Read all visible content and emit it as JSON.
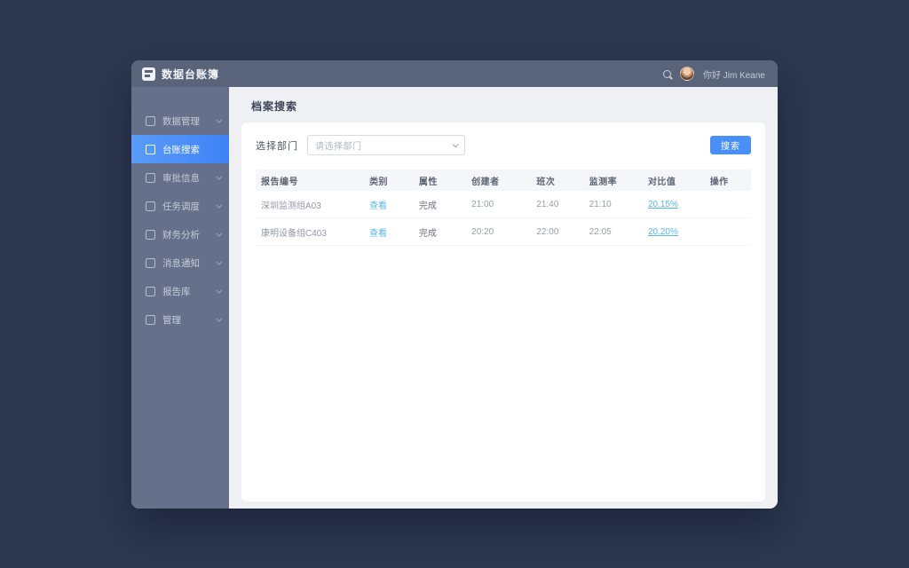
{
  "app": {
    "title": "数据台账簿",
    "greeting": "你好 Jim Keane"
  },
  "sidebar": {
    "items": [
      {
        "label": "数据管理",
        "active": false
      },
      {
        "label": "台账搜索",
        "active": true
      },
      {
        "label": "审批信息",
        "active": false
      },
      {
        "label": "任务调度",
        "active": false
      },
      {
        "label": "财务分析",
        "active": false
      },
      {
        "label": "消息通知",
        "active": false
      },
      {
        "label": "报告库",
        "active": false
      },
      {
        "label": "管理",
        "active": false
      }
    ]
  },
  "page": {
    "title": "档案搜索"
  },
  "filter": {
    "label": "选择部门",
    "select_value": "请选择部门",
    "search_button": "搜索"
  },
  "table": {
    "headers": [
      "报告编号",
      "类别",
      "属性",
      "创建者",
      "班次",
      "监测率",
      "对比值",
      "操作"
    ],
    "rows": [
      {
        "cells": [
          "深圳监测组A03",
          "查看",
          "完成",
          "21:00",
          "21:40",
          "21:10",
          "20.15%",
          ""
        ]
      },
      {
        "cells": [
          "康明设备组C403",
          "查看",
          "完成",
          "20:20",
          "22:00",
          "22:05",
          "20.20%",
          ""
        ]
      }
    ]
  },
  "colors": {
    "accent": "#4a8ff7",
    "link": "#57b8e8",
    "header_bar": "#59637a",
    "sidebar": "#67708a",
    "background": "#2d3850"
  }
}
